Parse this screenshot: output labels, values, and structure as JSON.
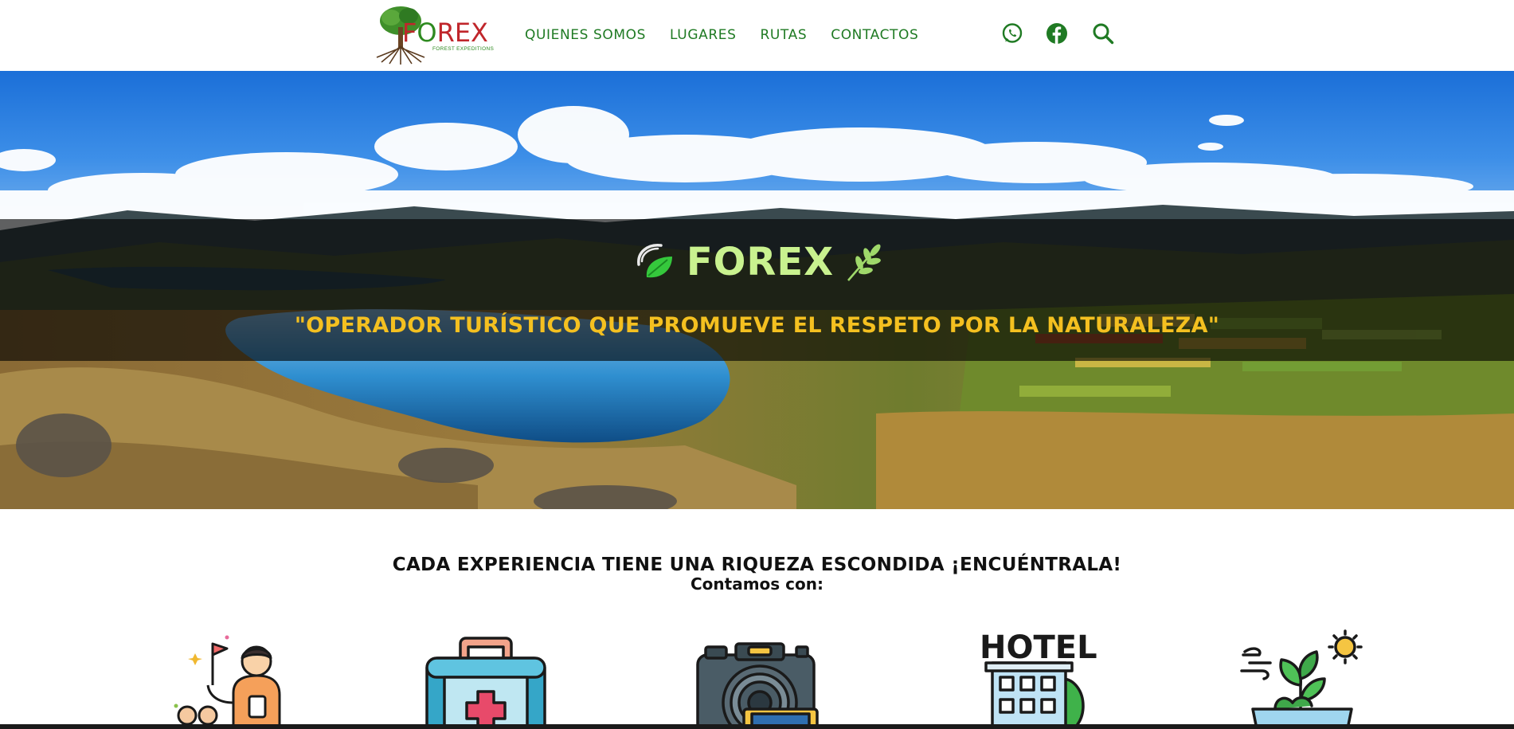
{
  "header": {
    "logo": {
      "word_first": "F",
      "word_o": "O",
      "word_rest": "REX",
      "subtitle": "FOREST EXPEDITIONS",
      "icon": "tree-icon"
    },
    "nav": [
      {
        "label": "QUIENES SOMOS"
      },
      {
        "label": "LUGARES"
      },
      {
        "label": "RUTAS"
      },
      {
        "label": "CONTACTOS"
      }
    ],
    "icons": [
      "whatsapp-icon",
      "facebook-icon",
      "search-icon"
    ]
  },
  "hero": {
    "brand": "FOREX",
    "tagline": "\"OPERADOR TURÍSTICO QUE PROMUEVE EL RESPETO POR LA NATURALEZA\"",
    "icons": [
      "leaf-swirl-icon",
      "leaf-branch-icon"
    ]
  },
  "section": {
    "headline": "CADA EXPERIENCIA TIENE UNA RIQUEZA ESCONDIDA ¡ENCUÉNTRALA!",
    "subhead": "Contamos con:",
    "features": [
      {
        "icon": "guide-icon"
      },
      {
        "icon": "first-aid-kit-icon"
      },
      {
        "icon": "camera-icon"
      },
      {
        "icon": "hotel-icon",
        "label": "HOTEL"
      },
      {
        "icon": "eco-plant-icon"
      }
    ]
  },
  "colors": {
    "nav": "#1f7a23",
    "brand": "#c9f28f",
    "tagline": "#f4c020",
    "logo_red": "#c0262b",
    "logo_green": "#2d8a1f"
  }
}
